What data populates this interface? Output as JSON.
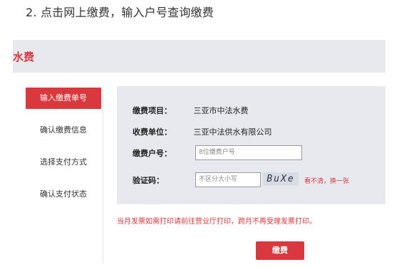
{
  "heading": "2. 点击网上缴费，输入户号查询缴费",
  "service": {
    "title": "水费"
  },
  "steps": [
    {
      "label": "输入缴费单号",
      "active": true
    },
    {
      "label": "确认缴费信息",
      "active": false
    },
    {
      "label": "选择支付方式",
      "active": false
    },
    {
      "label": "确认支付状态",
      "active": false
    }
  ],
  "form": {
    "item_label": "缴费项目：",
    "item_value": "三亚市中法水费",
    "unit_label": "收费单位：",
    "unit_value": "三亚中法供水有限公司",
    "account_label": "缴费户号：",
    "account_placeholder": "8位缴费户号",
    "captcha_label": "验证码：",
    "captcha_placeholder": "不区分大小写",
    "captcha_text": "BuXe",
    "captcha_refresh": "看不清，换一张"
  },
  "notice": "当月发票如需打印请前往营业厅打印，跨月不再受理发票打印。",
  "pay_button": "缴费",
  "colors": {
    "accent": "#d9383e",
    "panel": "#e8e9ee"
  }
}
